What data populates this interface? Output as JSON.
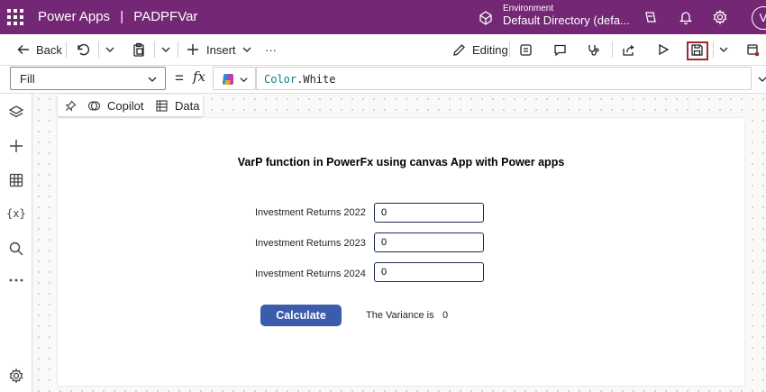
{
  "header": {
    "app_name": "Power Apps",
    "separator": "|",
    "app_title": "PADPFVar",
    "environment_label": "Environment",
    "environment_value": "Default Directory (defa...",
    "avatar_initial": "V"
  },
  "toolbar": {
    "back_label": "Back",
    "insert_label": "Insert",
    "more_label": "···",
    "editing_label": "Editing"
  },
  "formula": {
    "property": "Fill",
    "equals": "=",
    "fx": "fx",
    "object": "Color",
    "dot": ".",
    "member": "White"
  },
  "floatbar": {
    "copilot_label": "Copilot",
    "data_label": "Data"
  },
  "screen": {
    "title": "VarP function in PowerFx using canvas App with Power apps",
    "fields": [
      {
        "label": "Investment Returns 2022",
        "value": "0"
      },
      {
        "label": "Investment Returns 2023",
        "value": "0"
      },
      {
        "label": "Investment Returns 2024",
        "value": "0"
      }
    ],
    "calculate_label": "Calculate",
    "variance_label": "The Variance is",
    "variance_value": "0"
  },
  "colors": {
    "brand": "#742774",
    "button": "#3b5bab",
    "textbox_border": "#1b2a4e",
    "highlight": "#a4262c"
  }
}
